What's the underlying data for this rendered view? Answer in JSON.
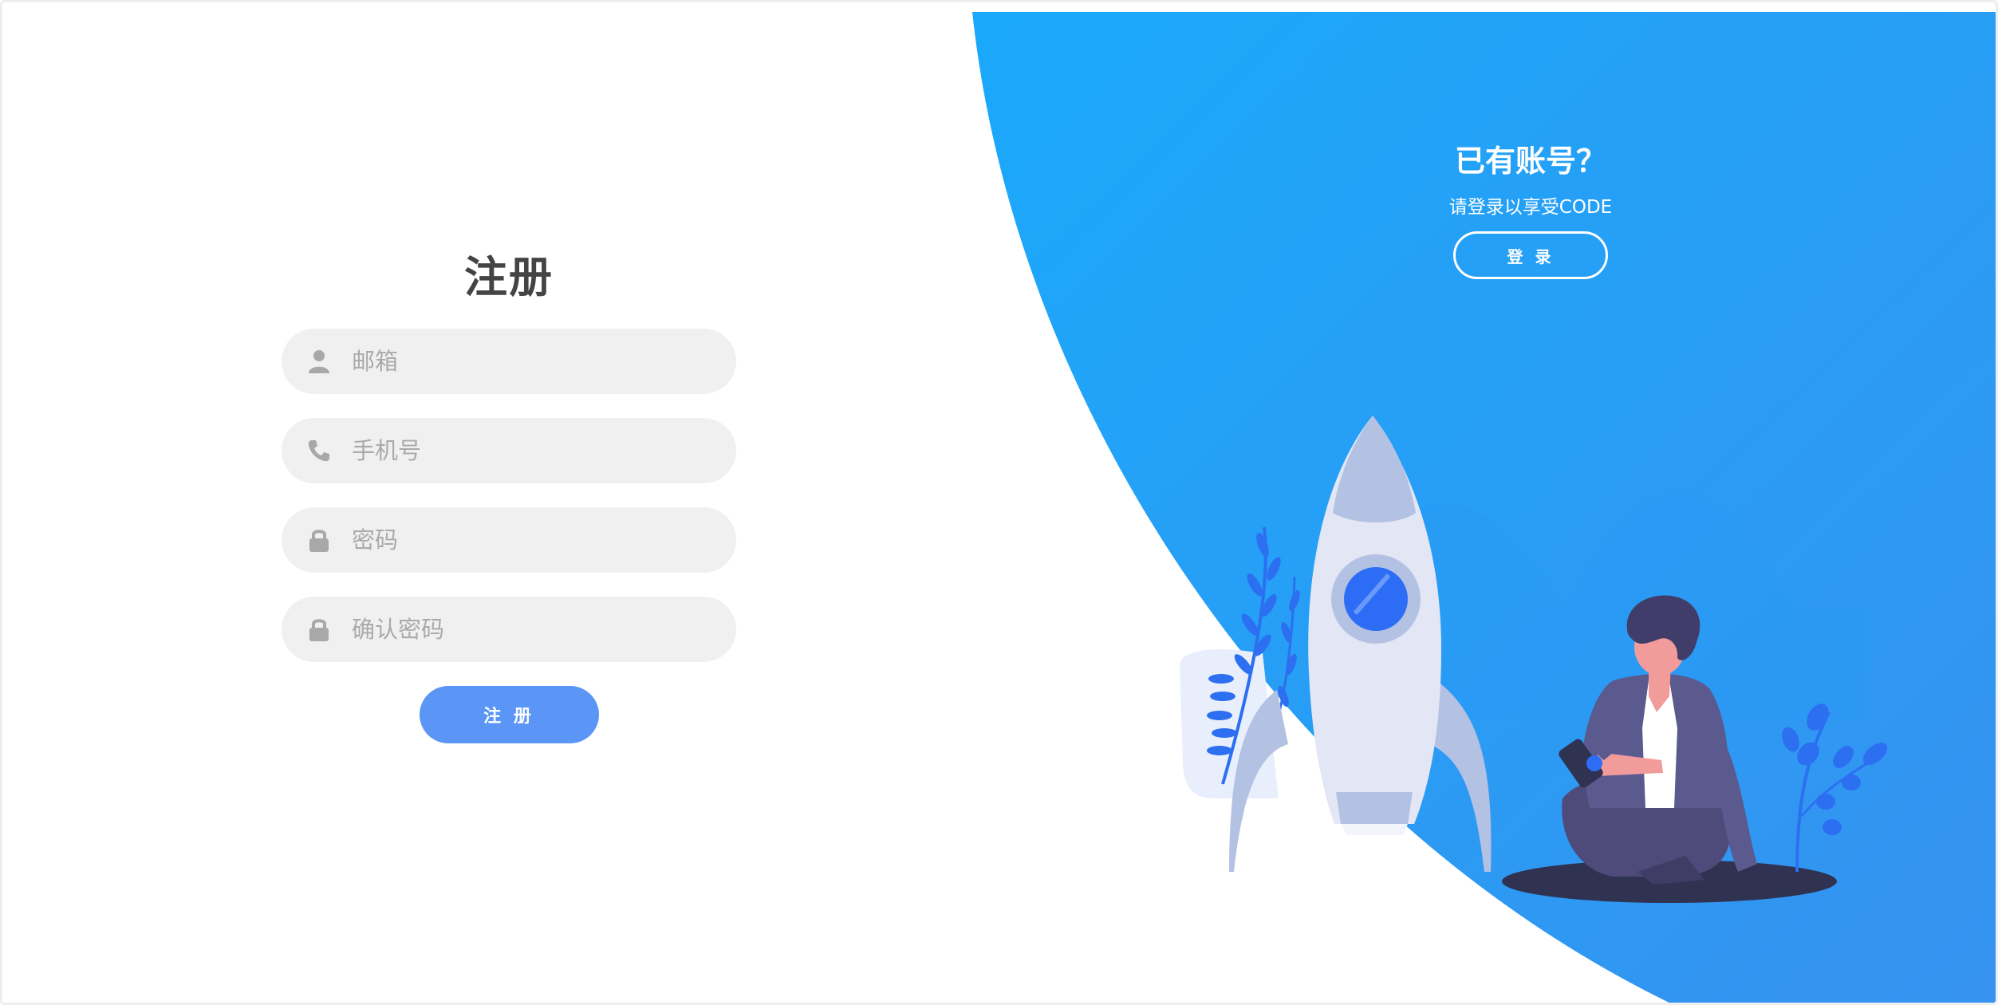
{
  "register_form": {
    "title": "注册",
    "fields": [
      {
        "icon": "user-icon",
        "placeholder": "邮箱",
        "value": ""
      },
      {
        "icon": "phone-icon",
        "placeholder": "手机号",
        "value": ""
      },
      {
        "icon": "lock-icon",
        "placeholder": "密码",
        "value": ""
      },
      {
        "icon": "lock-icon",
        "placeholder": "确认密码",
        "value": ""
      }
    ],
    "submit_label": "注 册"
  },
  "login_panel": {
    "heading": "已有账号？",
    "subtext": "请登录以享受CODE",
    "login_label": "登 录"
  },
  "colors": {
    "panel_blue_start": "#1aa9fb",
    "panel_blue_end": "#3692ef",
    "submit_button": "#5b95f5",
    "field_background": "#f0f0f0",
    "title_text": "#444444",
    "placeholder_text": "#aaaaaa"
  }
}
